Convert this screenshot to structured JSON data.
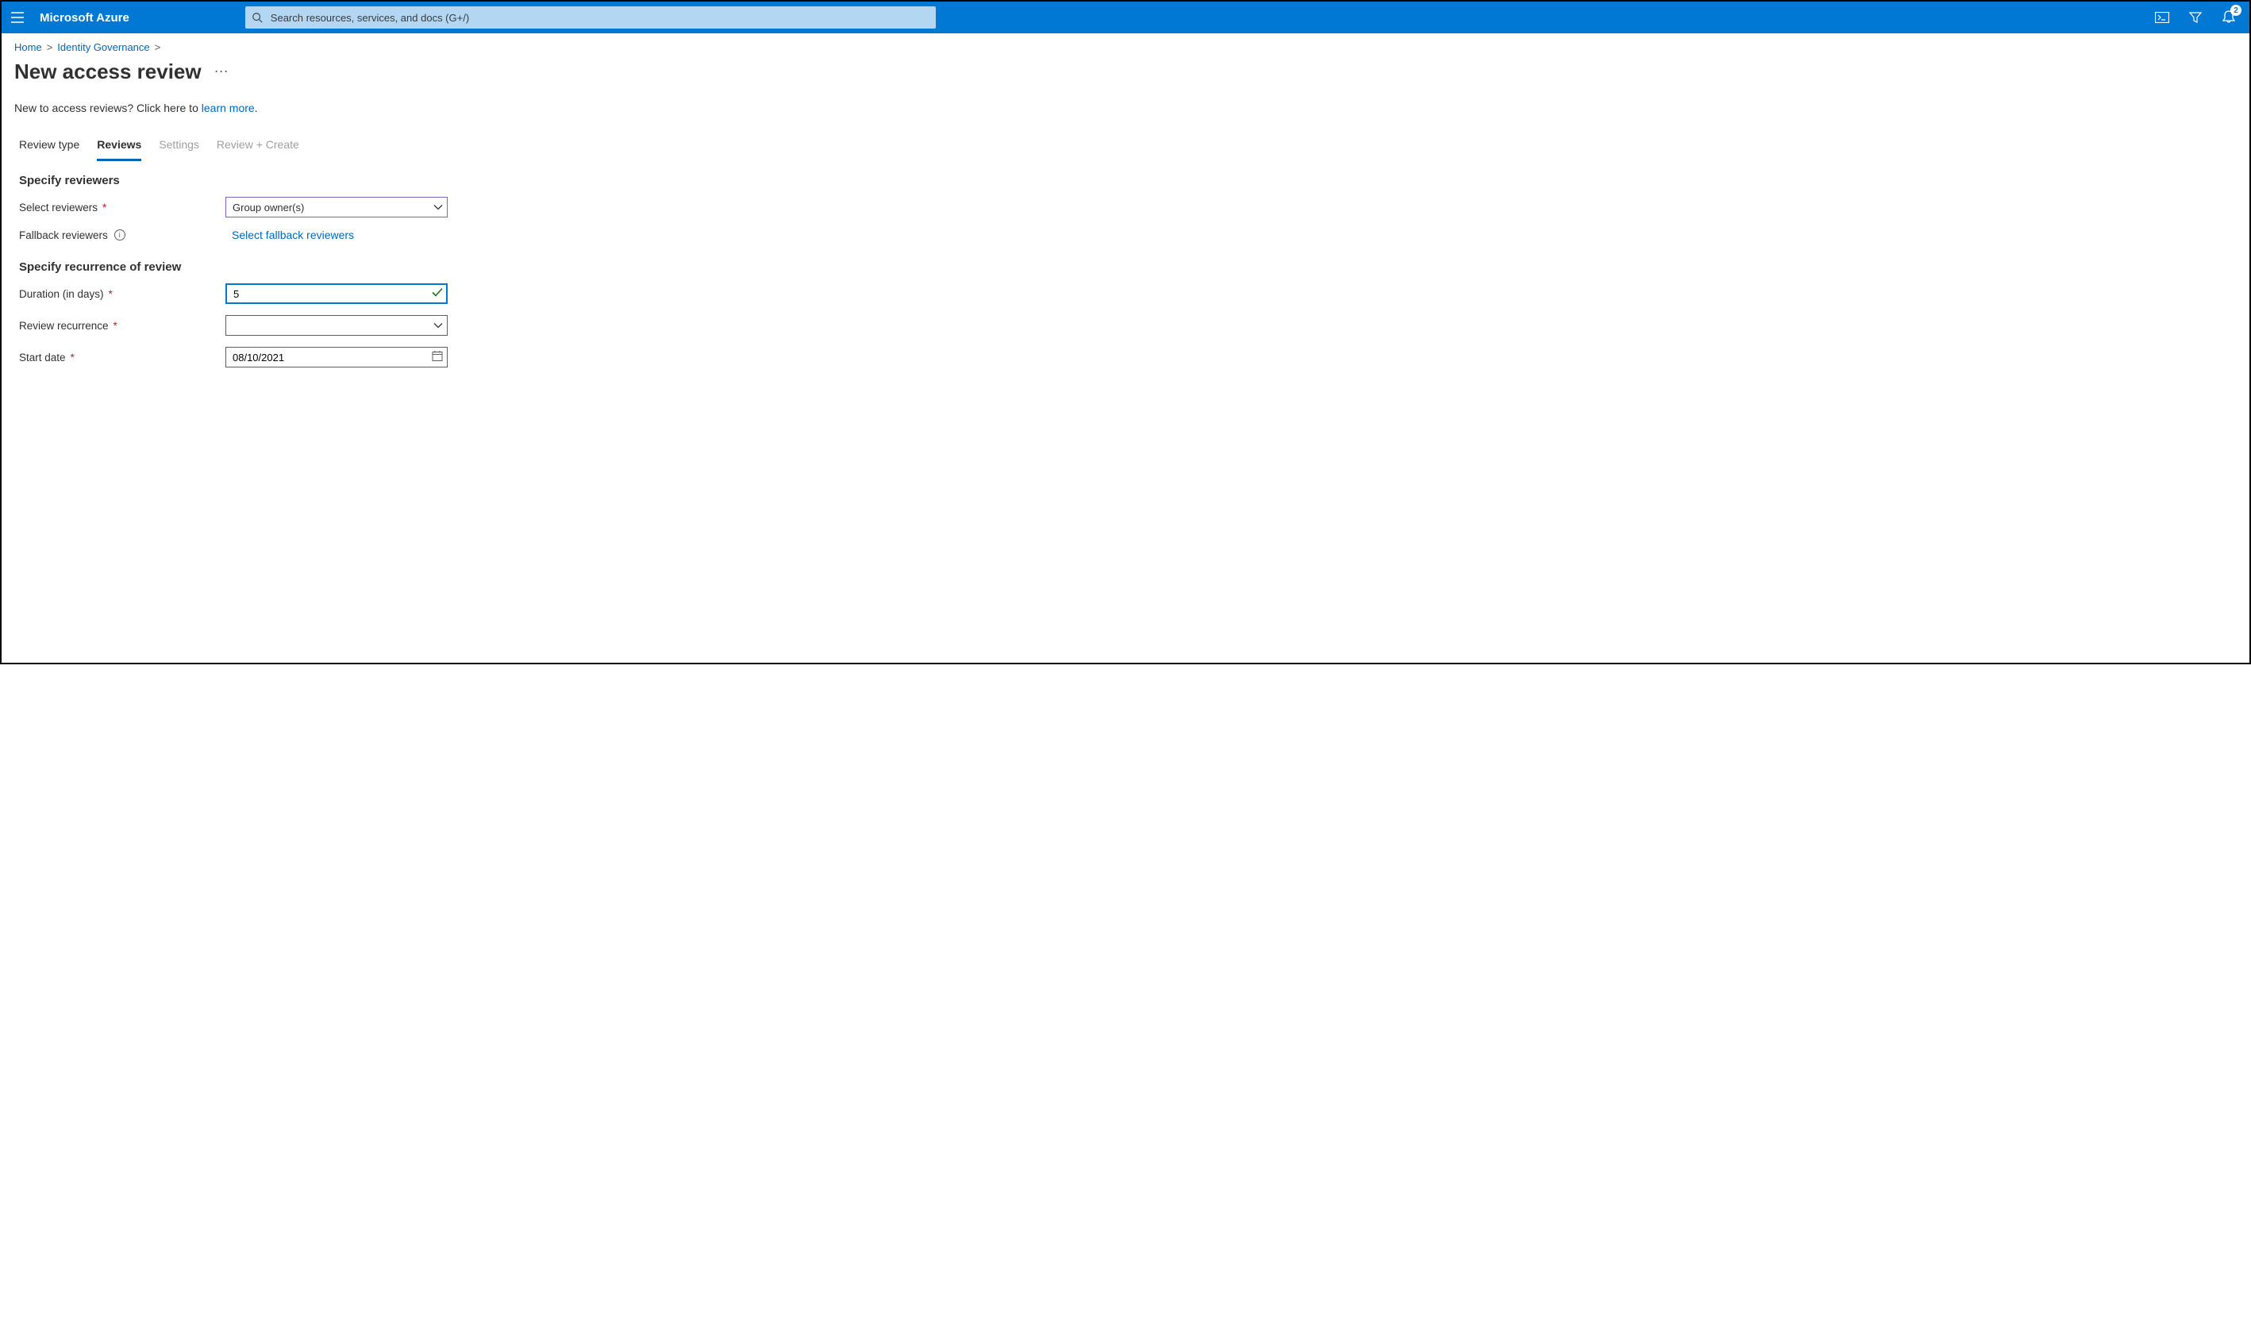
{
  "header": {
    "brand": "Microsoft Azure",
    "search_placeholder": "Search resources, services, and docs (G+/)",
    "notification_count": "2"
  },
  "breadcrumbs": {
    "items": [
      "Home",
      "Identity Governance"
    ]
  },
  "page": {
    "title": "New access review",
    "helper_prefix": "New to access reviews? Click here to ",
    "helper_link": "learn more",
    "helper_suffix": "."
  },
  "tabs": [
    {
      "label": "Review type",
      "state": "normal"
    },
    {
      "label": "Reviews",
      "state": "active"
    },
    {
      "label": "Settings",
      "state": "disabled"
    },
    {
      "label": "Review + Create",
      "state": "disabled"
    }
  ],
  "section1": {
    "header": "Specify reviewers",
    "select_reviewers_label": "Select reviewers",
    "select_reviewers_value": "Group owner(s)",
    "fallback_label": "Fallback reviewers",
    "fallback_action": "Select fallback reviewers"
  },
  "section2": {
    "header": "Specify recurrence of review",
    "duration_label": "Duration (in days)",
    "duration_value": "5",
    "recurrence_label": "Review recurrence",
    "recurrence_value": "",
    "start_date_label": "Start date",
    "start_date_value": "08/10/2021"
  }
}
